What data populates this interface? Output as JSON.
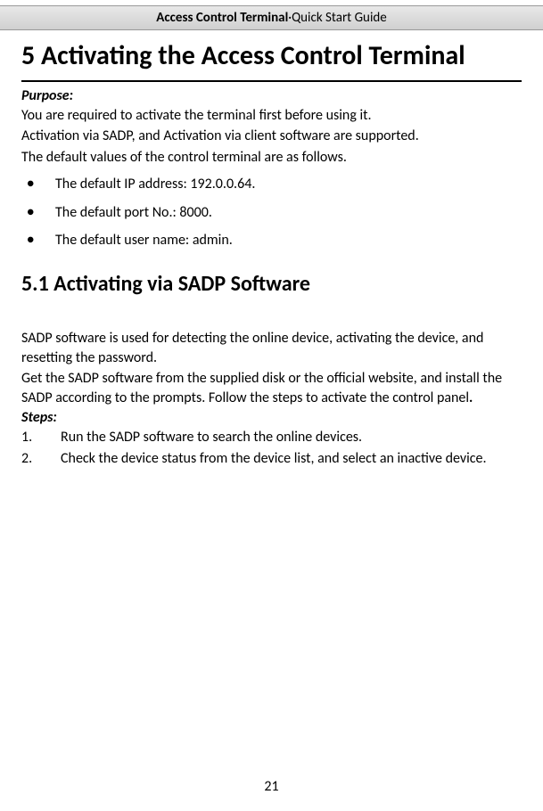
{
  "header": {
    "product": "Access Control Terminal",
    "separator": "·",
    "doc_type": "Quick Start Guide"
  },
  "chapter": {
    "title": "5 Activating the Access Control Terminal"
  },
  "purpose": {
    "label": "Purpose:",
    "lines": {
      "p1": "You are required to activate the terminal first before using it.",
      "p2": "Activation via SADP, and Activation via client software are supported.",
      "p3": "The default values of the control terminal are as follows."
    }
  },
  "defaults": {
    "items": {
      "0": "The default IP address: 192.0.0.64.",
      "1": "The default port No.: 8000.",
      "2": "The default user name: admin."
    }
  },
  "section": {
    "title": "5.1 Activating via SADP Software"
  },
  "sadp_intro": {
    "p1": "SADP software is used for detecting the online device, activating the device, and resetting the password.",
    "p2_prefix": "Get the SADP software from the supplied disk or the official website, and install the SADP according to the prompts. Follow the steps to activate the control panel",
    "p2_suffix": "."
  },
  "steps": {
    "label": "Steps:",
    "items": {
      "0": "Run the SADP software to search the online devices.",
      "1": "Check the device status from the device list, and select an inactive device."
    }
  },
  "page_number": "21"
}
